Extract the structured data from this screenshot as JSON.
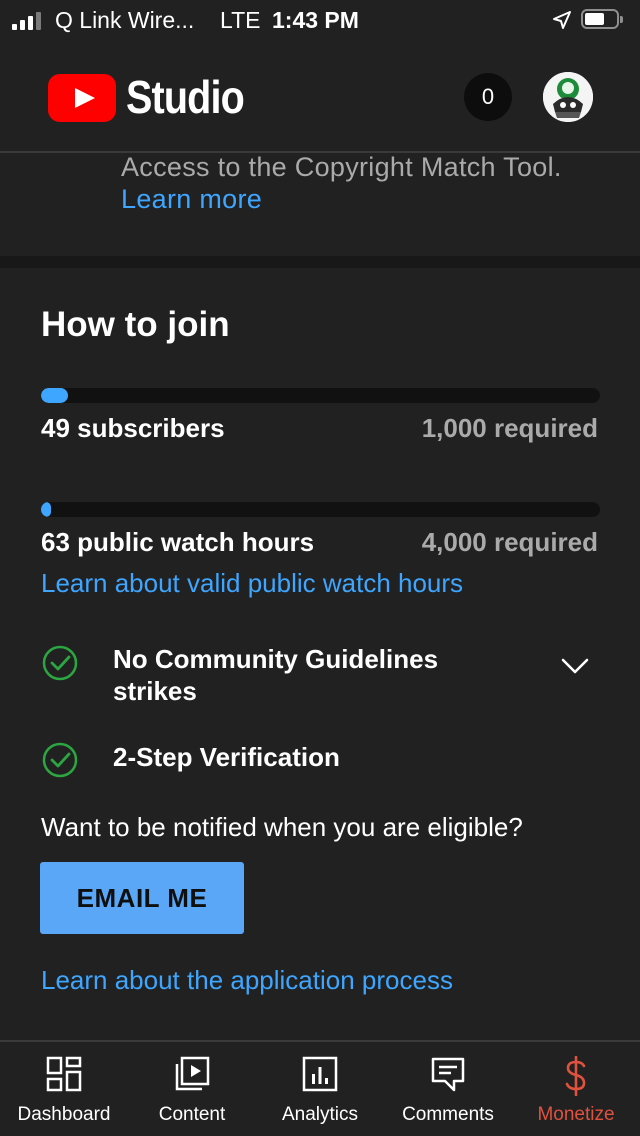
{
  "status_bar": {
    "carrier": "Q Link Wire...",
    "network": "LTE",
    "time": "1:43 PM",
    "battery_level": 0.72
  },
  "header": {
    "app_name": "Studio",
    "notification_count": "0",
    "logo_color": "#ff0000"
  },
  "copyright": {
    "text": "Access to the Copyright Match Tool.",
    "link": "Learn more"
  },
  "how_to_join": {
    "title": "How to join",
    "subscribers": {
      "label": "49 subscribers",
      "required": "1,000 required",
      "current": 49,
      "target": 1000
    },
    "watch_hours": {
      "label": "63 public watch hours",
      "required": "4,000 required",
      "current": 63,
      "target": 4000
    },
    "watch_hours_link": "Learn about valid public watch hours",
    "checks": [
      {
        "label": "No Community Guidelines strikes",
        "status": "passed"
      },
      {
        "label": "2-Step Verification",
        "status": "passed"
      }
    ],
    "notify_prompt": "Want to be notified when you are eligible?",
    "email_button": "EMAIL ME",
    "application_link": "Learn about the application process"
  },
  "bottom_nav": {
    "items": [
      {
        "label": "Dashboard",
        "icon": "dashboard-icon"
      },
      {
        "label": "Content",
        "icon": "content-icon"
      },
      {
        "label": "Analytics",
        "icon": "analytics-icon"
      },
      {
        "label": "Comments",
        "icon": "comments-icon"
      },
      {
        "label": "Monetize",
        "icon": "dollar-icon"
      }
    ],
    "active": "Monetize",
    "active_color": "#e0513e"
  },
  "colors": {
    "background": "#212121",
    "link": "#3ea6ff",
    "button": "#5aa7f8",
    "check": "#2ba640"
  }
}
